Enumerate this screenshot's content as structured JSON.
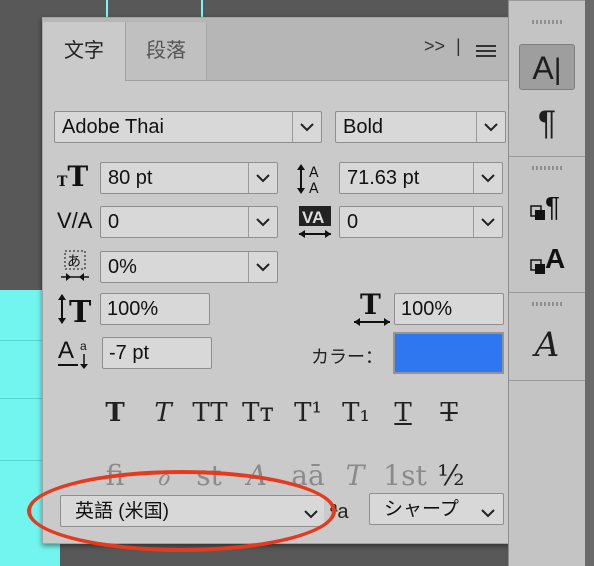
{
  "panel": {
    "tabs": [
      {
        "label": "文字"
      },
      {
        "label": "段落"
      }
    ],
    "collapse_label": ">>",
    "font_family": "Adobe Thai",
    "font_style": "Bold",
    "font_size": "80 pt",
    "leading": "71.63 pt",
    "kerning": "0",
    "tracking": "0",
    "tsume": "0%",
    "vertical_scale": "100%",
    "horizontal_scale": "100%",
    "baseline_shift": "-7 pt",
    "color_label": "カラー：",
    "color_value": "#2f77f0",
    "language": "英語 (米国)",
    "antialias_label": "ªa",
    "antialias": "シャープ"
  },
  "type_styles": [
    "T",
    "T",
    "TT",
    "Tт",
    "T¹",
    "T₁",
    "T",
    "T"
  ],
  "opentype": [
    "fi",
    "ℴ",
    "st",
    "A",
    "aā",
    "T",
    "1st",
    "½"
  ],
  "dock": {
    "items": [
      "character-panel",
      "paragraph-panel",
      "paragraph-styles",
      "character-styles",
      "glyphs"
    ]
  }
}
